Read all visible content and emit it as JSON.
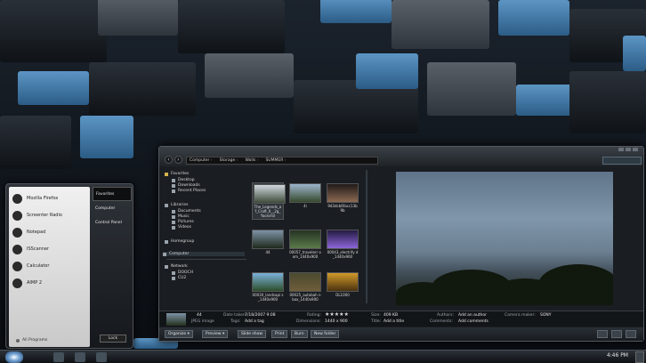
{
  "start_menu": {
    "programs": [
      "Mozilla Firefox",
      "Screenter Radio",
      "Notepad",
      "ISScanner",
      "Calculator",
      "AIMP 2"
    ],
    "right_links": [
      "Favorites",
      "Computer",
      "Control Panel"
    ],
    "all_programs": "All Programs",
    "lock_label": "Lock"
  },
  "explorer": {
    "address": [
      "Computer",
      "Storage",
      "Walls",
      "SUMMER"
    ],
    "nav": {
      "favorites": "Favorites",
      "fav_items": [
        "Desktop",
        "Downloads",
        "Recent Places"
      ],
      "libraries": "Libraries",
      "lib_items": [
        "Documents",
        "Music",
        "Pictures",
        "Videos"
      ],
      "homegroup": "Homegroup",
      "computer": "Computer",
      "network": "Network",
      "net_items": [
        "DOOCH",
        "CU2"
      ]
    },
    "files": [
      {
        "name": "The_Legends_of_Craft_II__2g_ Yoonshil",
        "colors": [
          "#cfd6dd",
          "#3d4a3a"
        ]
      },
      {
        "name": "4i",
        "colors": [
          "#9db4cc",
          "#364a2d"
        ]
      },
      {
        "name": "9d3dcb6facc13b 9b",
        "colors": [
          "#201a18",
          "#8c6a54"
        ]
      },
      {
        "name": "44",
        "colors": [
          "#7d92a6",
          "#1f2a1b"
        ]
      },
      {
        "name": "00057_travelerr oom_1440x900",
        "colors": [
          "#263323",
          "#5b7b4a"
        ]
      },
      {
        "name": "00043_electrify d_1440x900",
        "colors": [
          "#241b43",
          "#8c66d9"
        ]
      },
      {
        "name": "00030_landsapi s_1440x900",
        "colors": [
          "#7cb3d9",
          "#2c4d2a"
        ]
      },
      {
        "name": "00025_autobah nbox_1440x900",
        "colors": [
          "#4a4a2f",
          "#6f5d3a"
        ]
      },
      {
        "name": "DL1000",
        "colors": [
          "#d09a2a",
          "#4a3210"
        ]
      }
    ],
    "details": {
      "name": "44",
      "type": "JPEG image",
      "date_taken_label": "Date taken:",
      "date_taken": "7/18/2007 9:08",
      "tags_label": "Tags:",
      "tags": "Add a tag",
      "rating_label": "Rating:",
      "rating": 5,
      "dimensions_label": "Dimensions:",
      "dimensions": "1440 x 900",
      "size_label": "Size:",
      "size": "409 KB",
      "title_label": "Title:",
      "title": "Add a title",
      "authors_label": "Authors:",
      "authors": "Add an author",
      "comments_label": "Comments:",
      "comments": "Add comments",
      "camera_label": "Camera maker:",
      "camera": "SONY"
    },
    "toolbar": [
      "Organize ▾",
      "Preview ▾",
      "Slide show",
      "Print",
      "Burn",
      "New folder"
    ]
  },
  "taskbar": {
    "clock": "4:46 PM"
  },
  "colors": {
    "accent": "#5c95c4",
    "window_bg": "#1a1d21"
  }
}
